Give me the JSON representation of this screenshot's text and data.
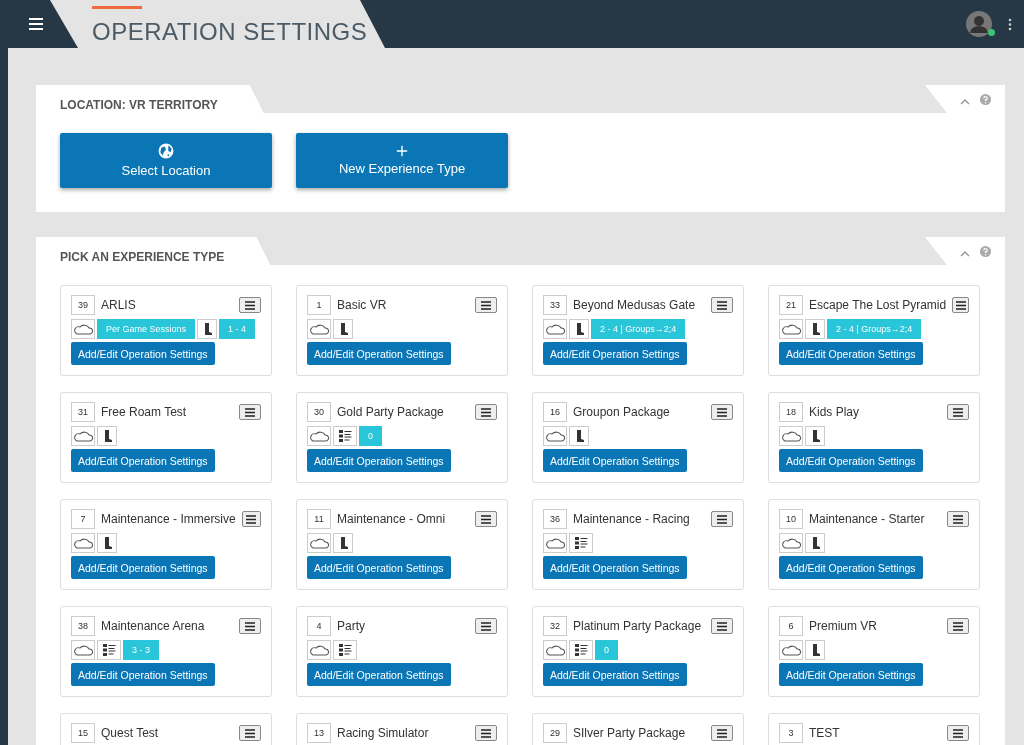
{
  "header": {
    "title": "OPERATION SETTINGS",
    "user_online": true
  },
  "location_panel": {
    "title": "LOCATION: VR TERRITORY",
    "buttons": [
      {
        "kind": "globe",
        "label": "Select Location"
      },
      {
        "kind": "plus",
        "label": "New Experience Type"
      }
    ]
  },
  "experience_panel": {
    "title": "PICK AN EXPERIENCE TYPE",
    "cards": [
      {
        "id": "39",
        "name": "ARLIS",
        "tags": [
          {
            "kind": "cloud"
          },
          {
            "kind": "badge",
            "text": "Per Game Sessions"
          },
          {
            "kind": "boot"
          },
          {
            "kind": "badge",
            "text": "1 - 4"
          }
        ],
        "button": "Add/Edit Operation Settings"
      },
      {
        "id": "1",
        "name": "Basic VR",
        "tags": [
          {
            "kind": "cloud"
          },
          {
            "kind": "boot"
          }
        ],
        "button": "Add/Edit Operation Settings"
      },
      {
        "id": "33",
        "name": "Beyond Medusas Gate",
        "tags": [
          {
            "kind": "cloud"
          },
          {
            "kind": "boot"
          },
          {
            "kind": "badge",
            "text": "2 - 4 | Groups→2;4"
          }
        ],
        "button": "Add/Edit Operation Settings"
      },
      {
        "id": "21",
        "name": "Escape The Lost Pyramid",
        "tags": [
          {
            "kind": "cloud"
          },
          {
            "kind": "boot"
          },
          {
            "kind": "badge",
            "text": "2 - 4 | Groups→2;4"
          }
        ],
        "button": "Add/Edit Operation Settings"
      },
      {
        "id": "31",
        "name": "Free Roam Test",
        "tags": [
          {
            "kind": "cloud"
          },
          {
            "kind": "boot"
          }
        ],
        "button": "Add/Edit Operation Settings"
      },
      {
        "id": "30",
        "name": "Gold Party Package",
        "tags": [
          {
            "kind": "cloud"
          },
          {
            "kind": "list"
          },
          {
            "kind": "badge",
            "text": "0"
          }
        ],
        "button": "Add/Edit Operation Settings"
      },
      {
        "id": "16",
        "name": "Groupon Package",
        "tags": [
          {
            "kind": "cloud"
          },
          {
            "kind": "boot"
          }
        ],
        "button": "Add/Edit Operation Settings"
      },
      {
        "id": "18",
        "name": "Kids Play",
        "tags": [
          {
            "kind": "cloud"
          },
          {
            "kind": "boot"
          }
        ],
        "button": "Add/Edit Operation Settings"
      },
      {
        "id": "7",
        "name": "Maintenance - Immersive",
        "tags": [
          {
            "kind": "cloud"
          },
          {
            "kind": "boot"
          }
        ],
        "button": "Add/Edit Operation Settings"
      },
      {
        "id": "11",
        "name": "Maintenance - Omni",
        "tags": [
          {
            "kind": "cloud"
          },
          {
            "kind": "boot"
          }
        ],
        "button": "Add/Edit Operation Settings"
      },
      {
        "id": "36",
        "name": "Maintenance - Racing",
        "tags": [
          {
            "kind": "cloud"
          },
          {
            "kind": "list"
          }
        ],
        "button": "Add/Edit Operation Settings"
      },
      {
        "id": "10",
        "name": "Maintenance - Starter",
        "tags": [
          {
            "kind": "cloud"
          },
          {
            "kind": "boot"
          }
        ],
        "button": "Add/Edit Operation Settings"
      },
      {
        "id": "38",
        "name": "Maintenance Arena",
        "tags": [
          {
            "kind": "cloud"
          },
          {
            "kind": "list"
          },
          {
            "kind": "badge",
            "text": "3 - 3"
          }
        ],
        "button": "Add/Edit Operation Settings"
      },
      {
        "id": "4",
        "name": "Party",
        "tags": [
          {
            "kind": "cloud"
          },
          {
            "kind": "list"
          }
        ],
        "button": "Add/Edit Operation Settings"
      },
      {
        "id": "32",
        "name": "Platinum Party Package",
        "tags": [
          {
            "kind": "cloud"
          },
          {
            "kind": "list"
          },
          {
            "kind": "badge",
            "text": "0"
          }
        ],
        "button": "Add/Edit Operation Settings"
      },
      {
        "id": "6",
        "name": "Premium VR",
        "tags": [
          {
            "kind": "cloud"
          },
          {
            "kind": "boot"
          }
        ],
        "button": "Add/Edit Operation Settings"
      },
      {
        "id": "15",
        "name": "Quest Test"
      },
      {
        "id": "13",
        "name": "Racing Simulator"
      },
      {
        "id": "29",
        "name": "SIlver Party Package"
      },
      {
        "id": "3",
        "name": "TEST"
      }
    ]
  }
}
